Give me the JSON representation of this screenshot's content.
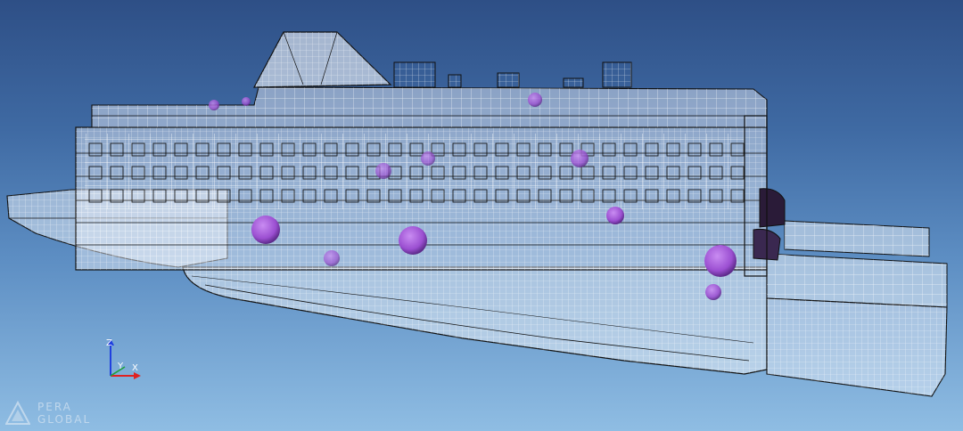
{
  "viewport": {
    "background_top": "#2e4f86",
    "background_bottom": "#8fbde3",
    "model": "ship-wireframe"
  },
  "colors": {
    "wire": "#ffffff",
    "wire_dim": "#dfe6f2",
    "hull_line": "#1a1a1a",
    "equipment": "#9b4fd1",
    "equipment_dark": "#5d2a8a",
    "axis_x": "#e02020",
    "axis_y": "#20a040",
    "axis_z": "#2040e0"
  },
  "triad": {
    "x_label": "X",
    "y_label": "Y",
    "z_label": "Z"
  },
  "brand": {
    "line1": "PERA",
    "line2": "GLOBAL"
  }
}
